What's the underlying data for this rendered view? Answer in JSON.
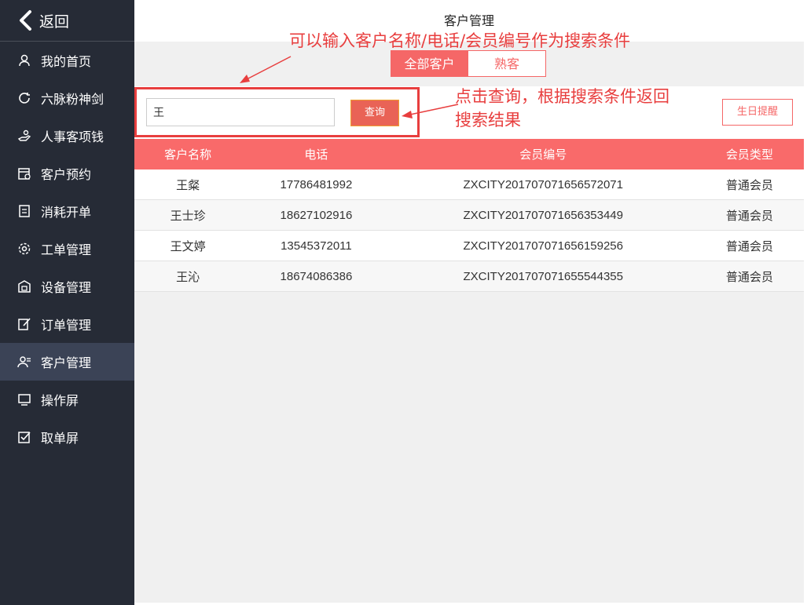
{
  "sidebar": {
    "back_label": "返回",
    "items": [
      {
        "label": "我的首页",
        "icon": "user-icon"
      },
      {
        "label": "六脉粉神剑",
        "icon": "refresh-icon"
      },
      {
        "label": "人事客项钱",
        "icon": "hand-money-icon"
      },
      {
        "label": "客户预约",
        "icon": "calendar-icon"
      },
      {
        "label": "消耗开单",
        "icon": "document-icon"
      },
      {
        "label": "工单管理",
        "icon": "gear-icon"
      },
      {
        "label": "设备管理",
        "icon": "building-icon"
      },
      {
        "label": "订单管理",
        "icon": "edit-icon"
      },
      {
        "label": "客户管理",
        "icon": "users-icon",
        "active": true
      },
      {
        "label": "操作屏",
        "icon": "monitor-icon"
      },
      {
        "label": "取单屏",
        "icon": "checkbox-icon"
      }
    ]
  },
  "header": {
    "title": "客户管理"
  },
  "tabs": {
    "all": "全部客户",
    "familiar": "熟客"
  },
  "search": {
    "value": "王",
    "query_label": "查询",
    "birthday_label": "生日提醒"
  },
  "table": {
    "columns": [
      "客户名称",
      "电话",
      "会员编号",
      "会员类型"
    ],
    "rows": [
      [
        "王粲",
        "17786481992",
        "ZXCITY201707071656572071",
        "普通会员"
      ],
      [
        "王士珍",
        "18627102916",
        "ZXCITY201707071656353449",
        "普通会员"
      ],
      [
        "王文婷",
        "13545372011",
        "ZXCITY201707071656159256",
        "普通会员"
      ],
      [
        "王沁",
        "18674086386",
        "ZXCITY201707071655544355",
        "普通会员"
      ]
    ]
  },
  "annotations": {
    "search_hint": "可以输入客户名称/电话/会员编号作为搜索条件",
    "query_hint_line1": "点击查询，根据搜索条件返回",
    "query_hint_line2": "搜索结果"
  },
  "colors": {
    "sidebar_bg": "#262b36",
    "accent": "#f56767",
    "annotation": "#e83e3e"
  }
}
